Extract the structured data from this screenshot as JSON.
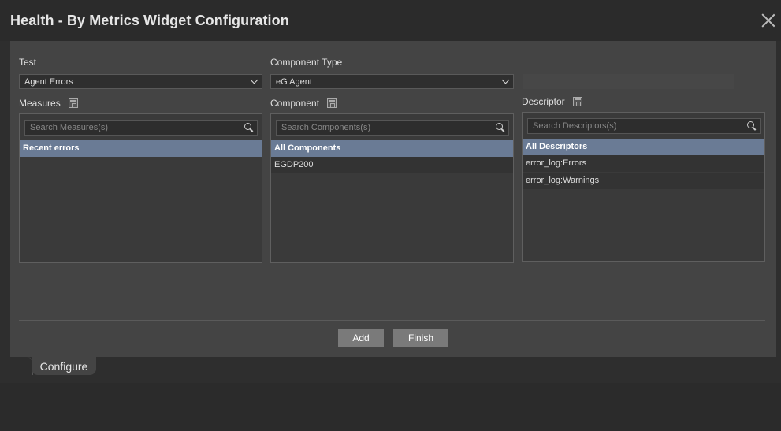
{
  "window": {
    "title": "Health - By Metrics Widget Configuration"
  },
  "test": {
    "label": "Test",
    "selected": "Agent Errors"
  },
  "component_type": {
    "label": "Component Type",
    "selected": "eG Agent"
  },
  "measures": {
    "label": "Measures",
    "search_placeholder": "Search Measures(s)",
    "items": [
      "Recent errors"
    ]
  },
  "component": {
    "label": "Component",
    "search_placeholder": "Search Components(s)",
    "items": [
      "All Components",
      "EGDP200"
    ]
  },
  "descriptor": {
    "label": "Descriptor",
    "search_placeholder": "Search Descriptors(s)",
    "items": [
      "All Descriptors",
      "error_log:Errors",
      "error_log:Warnings"
    ]
  },
  "buttons": {
    "add": "Add",
    "finish": "Finish"
  },
  "tabs": {
    "configure": "Configure"
  },
  "colors": {
    "selected_row": "#6a7b95",
    "button": "#7a7a7a"
  }
}
